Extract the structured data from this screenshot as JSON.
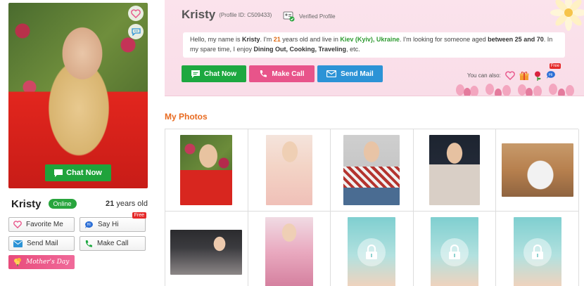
{
  "profile": {
    "name": "Kristy",
    "profile_id": "(Profile ID: C509433)",
    "verified": "Verified Profile",
    "online": "Online",
    "age_num": "21",
    "age_suffix": " years old"
  },
  "bio": {
    "p1": "Hello, my name is ",
    "name": "Kristy",
    "p2": ". I'm ",
    "age": "21",
    "p3": " years old and live in ",
    "location": "Kiev (Kyiv), Ukraine",
    "p4": ". I'm looking for someone aged ",
    "range": "between 25 and 70",
    "p5": ". In my spare time, I enjoy ",
    "hobbies": "Dining Out, Cooking, Traveling",
    "p6": ", etc."
  },
  "actions": {
    "chat": "Chat Now",
    "call": "Make Call",
    "mail": "Send Mail",
    "you_can_also": "You can also:"
  },
  "left_buttons": {
    "chat_overlay": "Chat Now",
    "favorite": "Favorite Me",
    "say_hi": "Say Hi",
    "free": "Free",
    "send_mail": "Send Mail",
    "make_call": "Make Call",
    "mothers_day": "Mother's Day"
  },
  "extras": {
    "hi": "Hi",
    "free": "Free"
  },
  "photos": {
    "title": "My Photos"
  },
  "colors": {
    "green": "#1da840",
    "pink": "#e8548a",
    "blue": "#2c93d6",
    "orange_heading": "#e86a1f"
  }
}
